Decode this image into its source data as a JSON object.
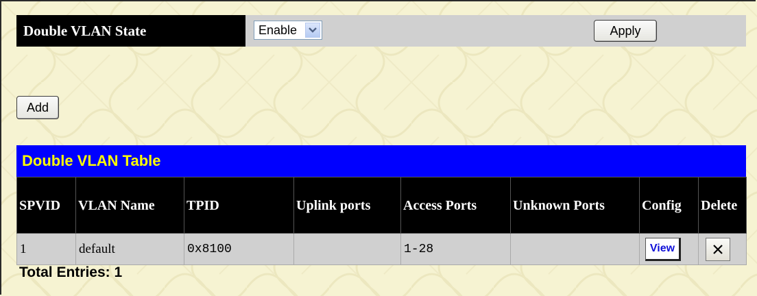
{
  "double_vlan_state": {
    "label": "Double VLAN State",
    "selected": "Enable",
    "apply_label": "Apply"
  },
  "add_label": "Add",
  "table": {
    "title": "Double VLAN Table",
    "headers": [
      "SPVID",
      "VLAN Name",
      "TPID",
      "Uplink ports",
      "Access Ports",
      "Unknown Ports",
      "Config",
      "Delete"
    ],
    "rows": [
      {
        "spvid": "1",
        "vlan_name": "default",
        "tpid": "0x8100",
        "uplink_ports": "",
        "access_ports": "1-28",
        "unknown_ports": "",
        "config_label": "View"
      }
    ]
  },
  "total_entries": "Total Entries: 1",
  "colors": {
    "background": "#f6f3d2",
    "header_bg": "#000000",
    "title_bar": "#0000ff",
    "title_text": "#ffff00",
    "cell_bg": "#d0d0d0",
    "link_blue": "#1010d8"
  },
  "icons": {
    "dropdown": "chevron-down-icon",
    "delete": "close-icon"
  }
}
